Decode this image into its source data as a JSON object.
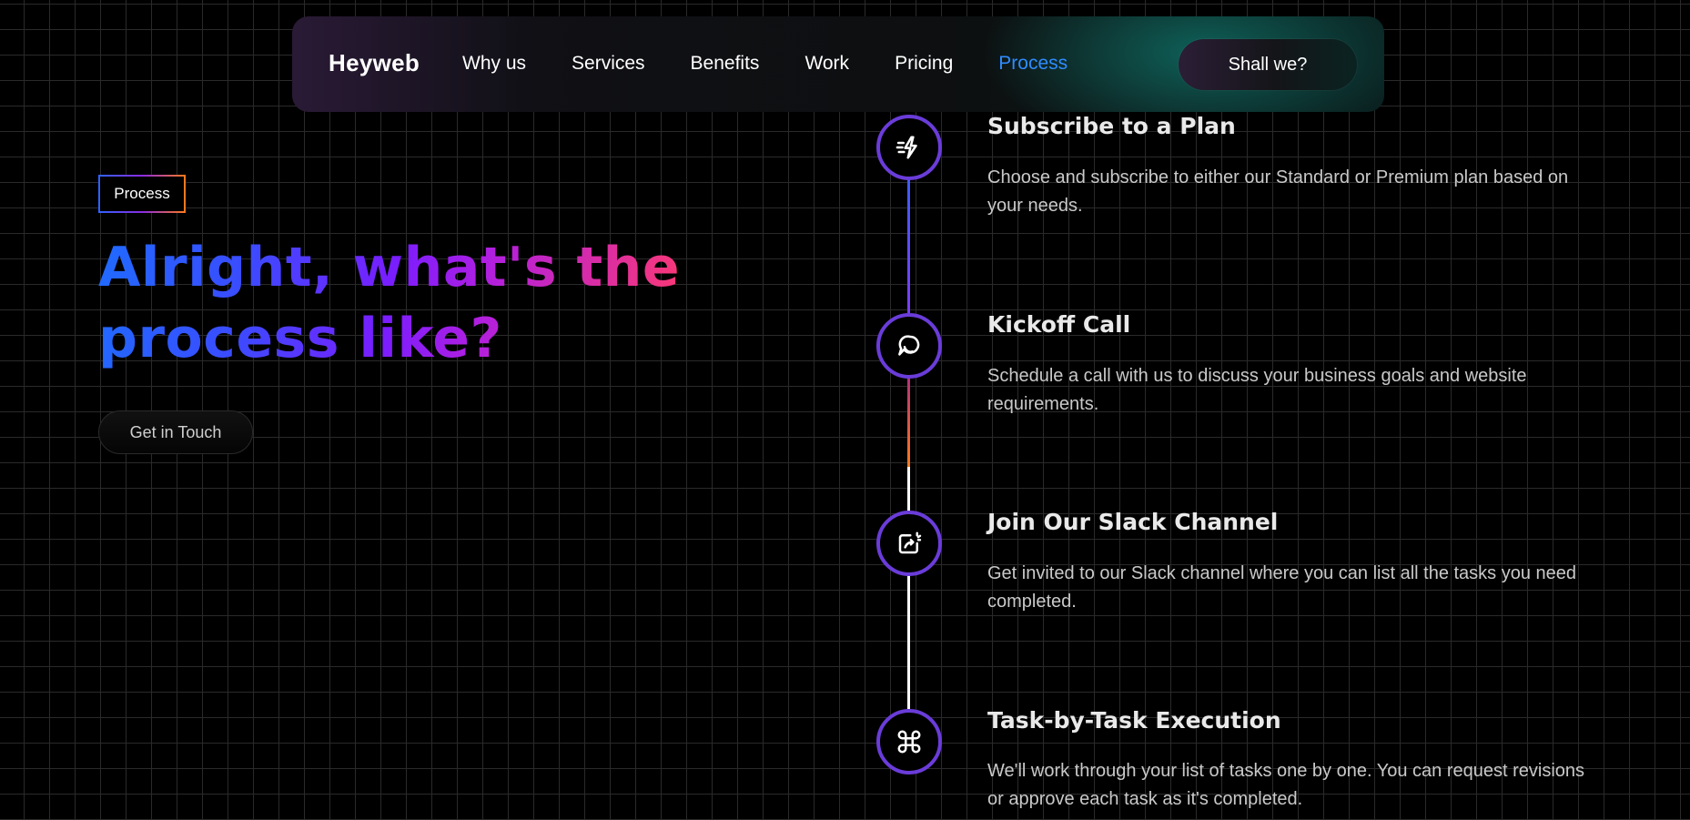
{
  "nav": {
    "brand": "Heyweb",
    "links": [
      {
        "label": "Why us"
      },
      {
        "label": "Services"
      },
      {
        "label": "Benefits"
      },
      {
        "label": "Work"
      },
      {
        "label": "Pricing"
      },
      {
        "label": "Process",
        "active": true
      }
    ],
    "cta_label": "Shall we?"
  },
  "hero": {
    "badge": "Process",
    "headline_line1": "Alright, what's the",
    "headline_line2": "process like?",
    "button_label": "Get in Touch"
  },
  "steps": [
    {
      "icon": "bolt-icon",
      "title": "Subscribe to a Plan",
      "description": "Choose and subscribe to either our Standard or Premium plan based on your needs."
    },
    {
      "icon": "chat-bubble-icon",
      "title": "Kickoff Call",
      "description": "Schedule a call with us to discuss your business goals and website requirements."
    },
    {
      "icon": "share-sparkle-icon",
      "title": "Join Our Slack Channel",
      "description": "Get invited to our Slack channel where you can list all the tasks you need completed."
    },
    {
      "icon": "command-icon",
      "title": "Task-by-Task Execution",
      "description": "We'll work through your list of tasks one by one. You can request revisions or approve each task as it's completed."
    }
  ],
  "colors": {
    "accent_active_link": "#2f8cff",
    "timeline_circle_border": "#6a3cd9",
    "background": "#000000"
  }
}
